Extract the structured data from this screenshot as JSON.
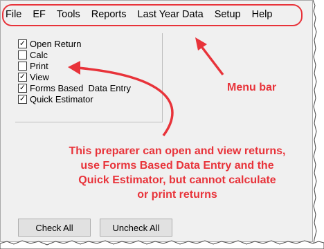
{
  "menu": {
    "items": [
      {
        "label": "File"
      },
      {
        "label": "EF"
      },
      {
        "label": "Tools"
      },
      {
        "label": "Reports"
      },
      {
        "label": "Last Year Data"
      },
      {
        "label": "Setup"
      },
      {
        "label": "Help"
      }
    ]
  },
  "permissions": [
    {
      "label": "Open Return",
      "checked": true
    },
    {
      "label": "Calc",
      "checked": false
    },
    {
      "label": "Print",
      "checked": false
    },
    {
      "label": "View",
      "checked": true
    },
    {
      "label": "Forms Based  Data Entry",
      "checked": true
    },
    {
      "label": "Quick Estimator",
      "checked": true
    }
  ],
  "annotations": {
    "menubar_label": "Menu bar",
    "description_lines": [
      "This preparer can open and view returns,",
      "use Forms Based Data Entry and the",
      "Quick Estimator, but cannot calculate",
      "or print returns"
    ],
    "accent_color": "#e8333a"
  },
  "buttons": {
    "check_all": "Check All",
    "uncheck_all": "Uncheck All"
  }
}
